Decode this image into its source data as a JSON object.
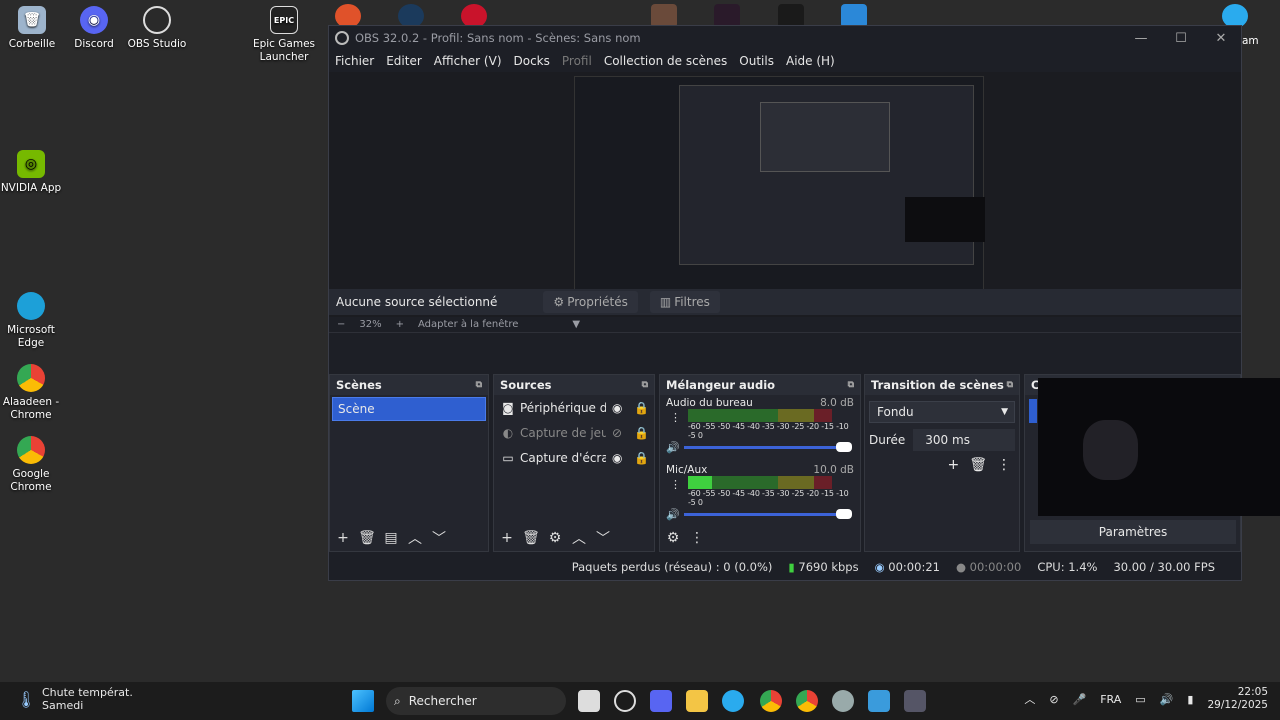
{
  "desktop": {
    "icons": [
      {
        "label": "Corbeille",
        "icon": "trash-icon",
        "color": "#9db4cc"
      },
      {
        "label": "Discord",
        "icon": "discord-icon",
        "color": "#5865f2"
      },
      {
        "label": "OBS Studio",
        "icon": "obs-icon",
        "color": "#2a2a2a"
      },
      {
        "label": "Epic Games Launcher",
        "icon": "epic-icon",
        "color": "#222"
      },
      {
        "label": "NVIDIA App",
        "icon": "nvidia-icon",
        "color": "#76b900"
      },
      {
        "label": "Microsoft Edge",
        "icon": "edge-icon",
        "color": "#1da0d8"
      },
      {
        "label": "Alaadeen - Chrome",
        "icon": "chrome-icon",
        "color": "#e94235"
      },
      {
        "label": "Google Chrome",
        "icon": "chrome-icon",
        "color": "#34a853"
      }
    ],
    "right_partial_label": "am"
  },
  "obs": {
    "title": "OBS 32.0.2 - Profil: Sans nom - Scènes: Sans nom",
    "menu": [
      "Fichier",
      "Editer",
      "Afficher (V)",
      "Docks",
      "Profil",
      "Collection de scènes",
      "Outils",
      "Aide (H)"
    ],
    "zoom": {
      "minus": "−",
      "value": "32%",
      "plus": "+",
      "fit": "Adapter à la fenêtre"
    },
    "source_bar": {
      "status": "Aucune source sélectionné",
      "properties": "Propriétés",
      "filters": "Filtres"
    },
    "scenes": {
      "title": "Scènes",
      "items": [
        "Scène"
      ]
    },
    "sources": {
      "title": "Sources",
      "items": [
        {
          "name": "Périphérique de capture",
          "icon": "camera-icon",
          "visible": true
        },
        {
          "name": "Capture de jeu",
          "icon": "gamepad-icon",
          "visible": false
        },
        {
          "name": "Capture d'écran",
          "icon": "monitor-icon",
          "visible": true
        }
      ]
    },
    "mixer": {
      "title": "Mélangeur audio",
      "scale": "-60 -55 -50 -45 -40 -35 -30 -25 -20 -15 -10 -5 0",
      "channels": [
        {
          "name": "Audio du bureau",
          "db": "8.0 dB"
        },
        {
          "name": "Mic/Aux",
          "db": "10.0 dB"
        }
      ]
    },
    "transitions": {
      "title": "Transition de scènes",
      "selected": "Fondu",
      "duration_label": "Durée",
      "duration": "300 ms"
    },
    "controls": {
      "title_partial": "C",
      "settings": "Paramètres"
    },
    "status": {
      "dropped": "Paquets perdus (réseau) : 0 (0.0%)",
      "bitrate": "7690 kbps",
      "live_time": "00:00:21",
      "rec_time": "00:00:00",
      "cpu": "CPU: 1.4%",
      "fps": "30.00 / 30.00 FPS"
    }
  },
  "taskbar": {
    "weather_title": "Chute températ.",
    "weather_sub": "Samedi",
    "search": "Rechercher",
    "lang": "FRA",
    "time": "22:05",
    "date": "29/12/2025"
  },
  "colors": {
    "accent": "#2f5fd0",
    "meter_green": "#2fa82f",
    "meter_yellow": "#a8a82a",
    "meter_red": "#a82a2a"
  }
}
